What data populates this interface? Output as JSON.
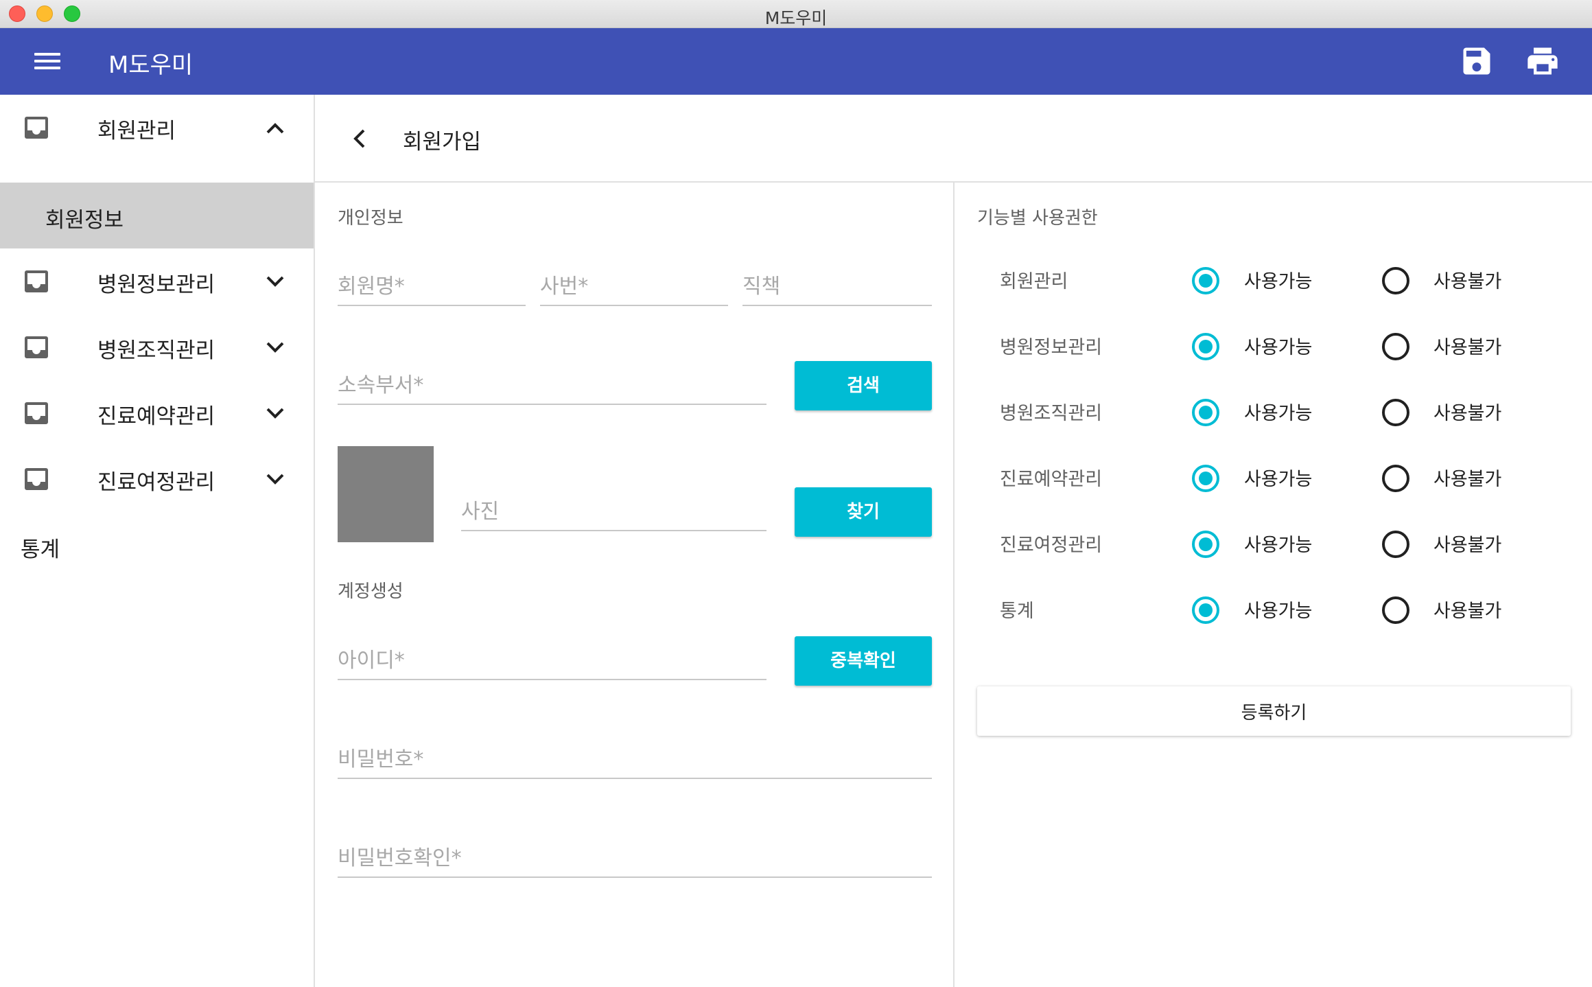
{
  "window": {
    "title": "M도우미"
  },
  "appbar": {
    "title": "M도우미",
    "menu_icon": "menu-icon",
    "actions": [
      "save-icon",
      "print-icon"
    ]
  },
  "sidebar": {
    "groups": [
      {
        "label": "회원관리",
        "expanded": true,
        "icon": "tray-icon",
        "chevron": "chevron-up-icon",
        "children": [
          {
            "label": "회원정보",
            "selected": true
          }
        ]
      },
      {
        "label": "병원정보관리",
        "expanded": false,
        "icon": "tray-icon",
        "chevron": "chevron-down-icon"
      },
      {
        "label": "병원조직관리",
        "expanded": false,
        "icon": "tray-icon",
        "chevron": "chevron-down-icon"
      },
      {
        "label": "진료예약관리",
        "expanded": false,
        "icon": "tray-icon",
        "chevron": "chevron-down-icon"
      },
      {
        "label": "진료여정관리",
        "expanded": false,
        "icon": "tray-icon",
        "chevron": "chevron-down-icon"
      }
    ],
    "standalone": {
      "label": "통계"
    }
  },
  "page": {
    "title": "회원가입",
    "back_icon": "chevron-left-icon"
  },
  "personal": {
    "section_label": "개인정보",
    "name_placeholder": "회원명*",
    "employee_no_placeholder": "사번*",
    "position_placeholder": "직책",
    "department_placeholder": "소속부서*",
    "search_button": "검색",
    "photo_placeholder": "사진",
    "find_button": "찾기"
  },
  "account": {
    "section_label": "계정생성",
    "id_placeholder": "아이디*",
    "check_button": "중복확인",
    "password_placeholder": "비밀번호*",
    "password_confirm_placeholder": "비밀번호확인*"
  },
  "permissions": {
    "section_label": "기능별 사용권한",
    "option_allow": "사용가능",
    "option_deny": "사용불가",
    "rows": [
      {
        "label": "회원관리",
        "value": "사용가능"
      },
      {
        "label": "병원정보관리",
        "value": "사용가능"
      },
      {
        "label": "병원조직관리",
        "value": "사용가능"
      },
      {
        "label": "진료예약관리",
        "value": "사용가능"
      },
      {
        "label": "진료여정관리",
        "value": "사용가능"
      },
      {
        "label": "통계",
        "value": "사용가능"
      }
    ],
    "submit_button": "등록하기"
  },
  "colors": {
    "appbar": "#3f51b5",
    "accent": "#00bcd4",
    "selected_nav": "#d0d0d0",
    "photo_placeholder": "#808080"
  }
}
